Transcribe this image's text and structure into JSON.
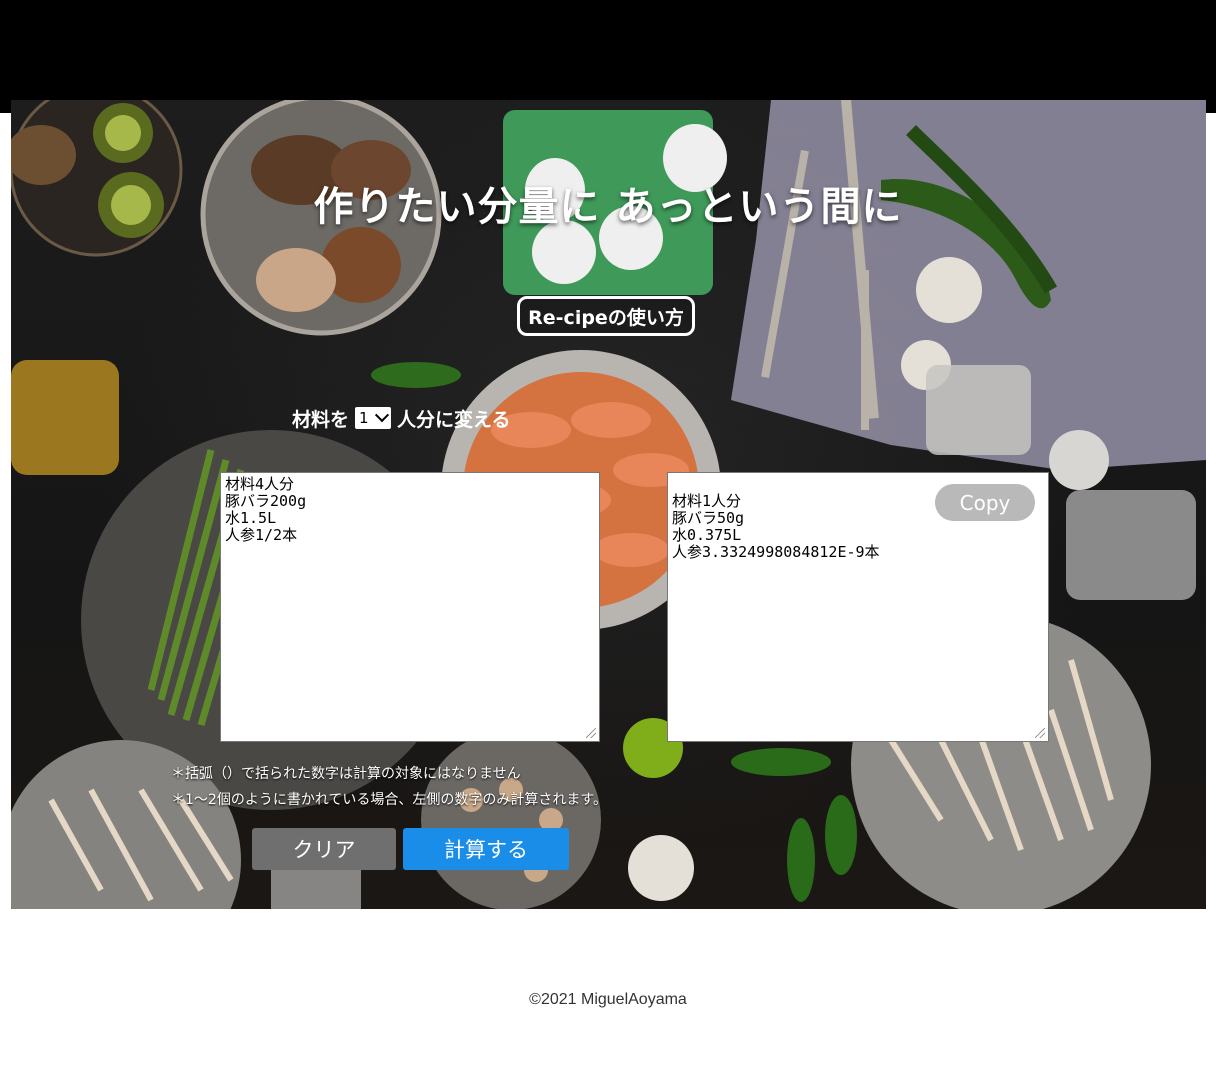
{
  "hero": {
    "headline": "作りたい分量に あっという間に",
    "howto_label": "Re-cipeの使い方"
  },
  "servings": {
    "prefix": "材料を",
    "selected_value": "1",
    "suffix": "人分に変える"
  },
  "input_text": "材料4人分\n豚バラ200g\n水1.5L\n人参1/2本",
  "output_text": "材料1人分\n豚バラ50g\n水0.375L\n人参3.3324998084812E-9本",
  "copy_label": "Copy",
  "notes": [
    "＊括弧（）で括られた数字は計算の対象にはなりません",
    "＊1〜2個のように書かれている場合、左側の数字のみ計算されます。"
  ],
  "buttons": {
    "clear_label": "クリア",
    "calculate_label": "計算する"
  },
  "footer": {
    "copyright": "©2021 MiguelAoyama"
  },
  "colors": {
    "calculate_button": "#1a8de8",
    "clear_button": "#6f6f6f",
    "copy_button": "#b9b9b9"
  }
}
